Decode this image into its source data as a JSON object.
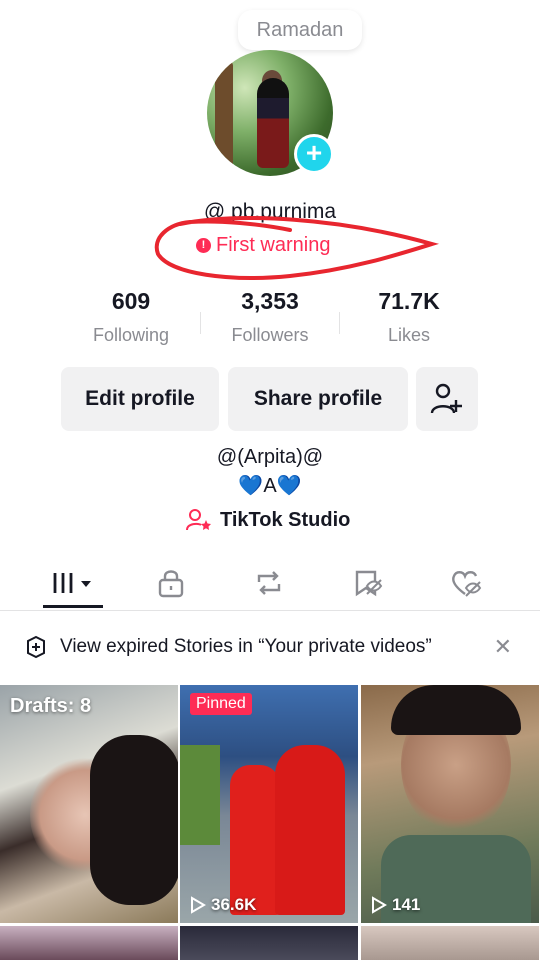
{
  "note": "Ramadan",
  "profile": {
    "username": "@ pb.purnima",
    "warning": "First warning"
  },
  "stats": [
    {
      "value": "609",
      "label": "Following"
    },
    {
      "value": "3,353",
      "label": "Followers"
    },
    {
      "value": "71.7K",
      "label": "Likes"
    }
  ],
  "buttons": {
    "edit": "Edit profile",
    "share": "Share profile"
  },
  "bio": {
    "line1": "@(Arpita)@",
    "line2": "💙A💙"
  },
  "studio": "TikTok Studio",
  "tabs": [
    "videos-icon",
    "lock-icon",
    "repost-icon",
    "favorites-icon",
    "liked-icon"
  ],
  "banner": {
    "text": "View expired Stories in “Your private videos”"
  },
  "grid": {
    "drafts": "Drafts: 8",
    "pinned": "Pinned",
    "views_1": "36.6K",
    "views_2": "141"
  },
  "colors": {
    "accent": "#fe2c55",
    "cyan": "#20d5ec",
    "text": "#161823",
    "muted": "#8a8b91"
  }
}
